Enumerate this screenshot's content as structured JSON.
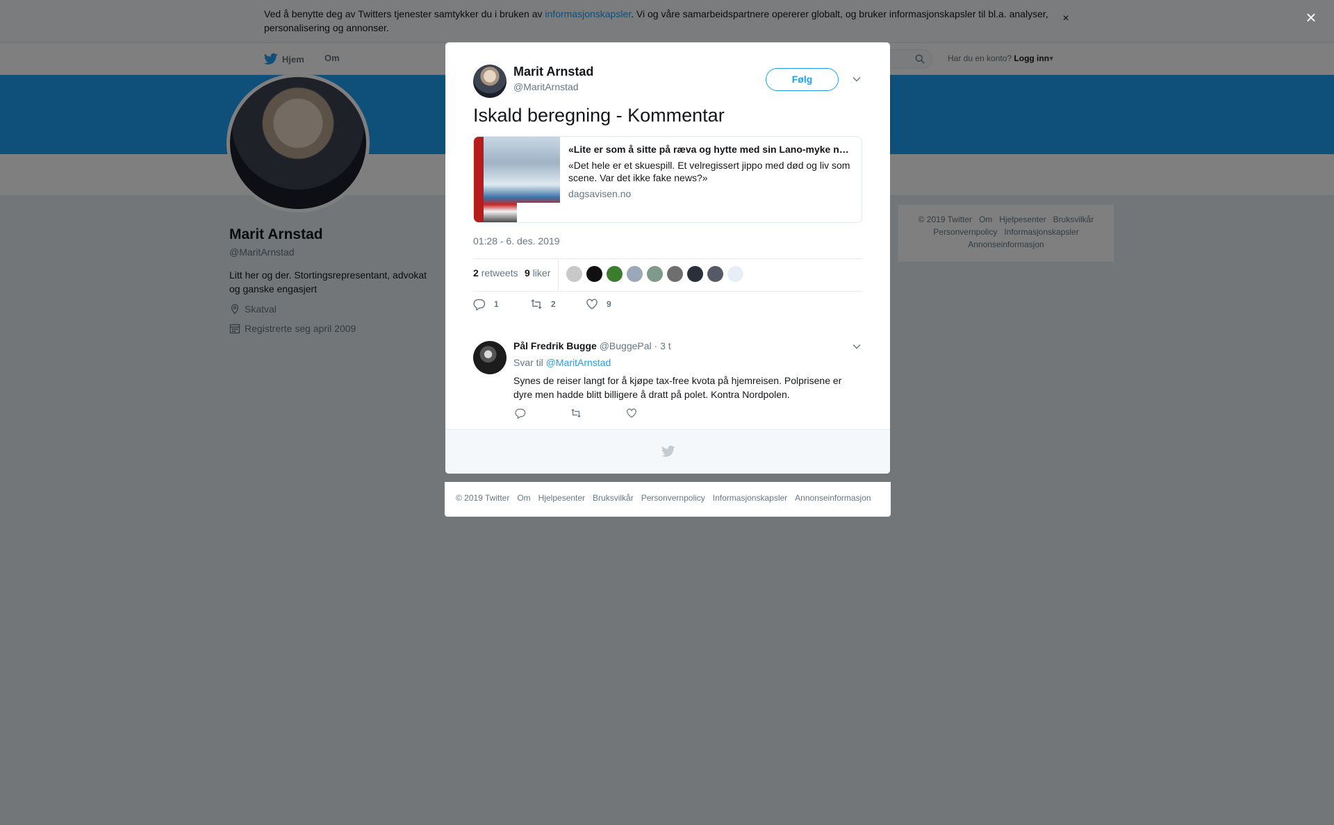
{
  "cookie_bar": {
    "text_before": "Ved å benytte deg av Twitters tjenester samtykker du i bruken av ",
    "link": "informasjonskapsler",
    "text_after": ". Vi og våre samarbeidspartnere opererer globalt, og bruker informasjonskapsler til bl.a. analyser, personalisering og annonser.",
    "close": "×"
  },
  "topnav": {
    "home": "Hjem",
    "about": "Om",
    "have_account": "Har du en konto?",
    "login": "Logg inn"
  },
  "profile": {
    "name": "Marit Arnstad",
    "handle": "@MaritArnstad",
    "bio": "Litt her og der. Stortingsrepresentant, advokat og ganske engasjert",
    "location": "Skatval",
    "joined": "Registrerte seg april 2009"
  },
  "side_footer": {
    "items": [
      "© 2019 Twitter",
      "Om",
      "Hjelpesenter",
      "Bruksvilkår",
      "Personvernpolicy",
      "Informasjonskapsler",
      "Annonseinformasjon"
    ]
  },
  "overlay": {
    "close": "×"
  },
  "tweet": {
    "name": "Marit Arnstad",
    "handle": "@MaritArnstad",
    "follow": "Følg",
    "text": "Iskald beregning - Kommentar",
    "card": {
      "title": "«Lite er som å sitte på ræva og hytte med sin Lano-myke neve mot Equinor»",
      "description": "«Det hele er et skuespill. Et velregissert jippo med død og liv som scene. Var det ikke fake news?»",
      "domain": "dagsavisen.no"
    },
    "time": "01:28 - 6. des. 2019",
    "retweets_count": "2",
    "retweets_label": "retweets",
    "likes_count": "9",
    "likes_label": "liker",
    "reply_count": "1",
    "retweet_count_action": "2",
    "like_count_action": "9",
    "liker_colors": [
      "#c8c8c8",
      "#101010",
      "#3a7d2c",
      "#9aa8b8",
      "#7f9a8a",
      "#6e6e6e",
      "#2a2f3a",
      "#555b66",
      "#e7eef5"
    ]
  },
  "reply": {
    "name": "Pål Fredrik Bugge",
    "handle": "@BuggePal",
    "age": "· 3 t",
    "reply_to_label": "Svar til",
    "reply_to_handle": "@MaritArnstad",
    "text": "Synes de reiser langt for å kjøpe tax-free kvota på hjemreisen. Polprisene er dyre men hadde blitt billigere å dratt på polet. Kontra Nordpolen."
  },
  "under_footer": {
    "items": [
      "© 2019 Twitter",
      "Om",
      "Hjelpesenter",
      "Bruksvilkår",
      "Personvernpolicy",
      "Informasjonskapsler",
      "Annonseinformasjon"
    ]
  },
  "colors": {
    "accent": "#1da1f2",
    "banner": "#1da1f2",
    "muted": "#657786"
  }
}
